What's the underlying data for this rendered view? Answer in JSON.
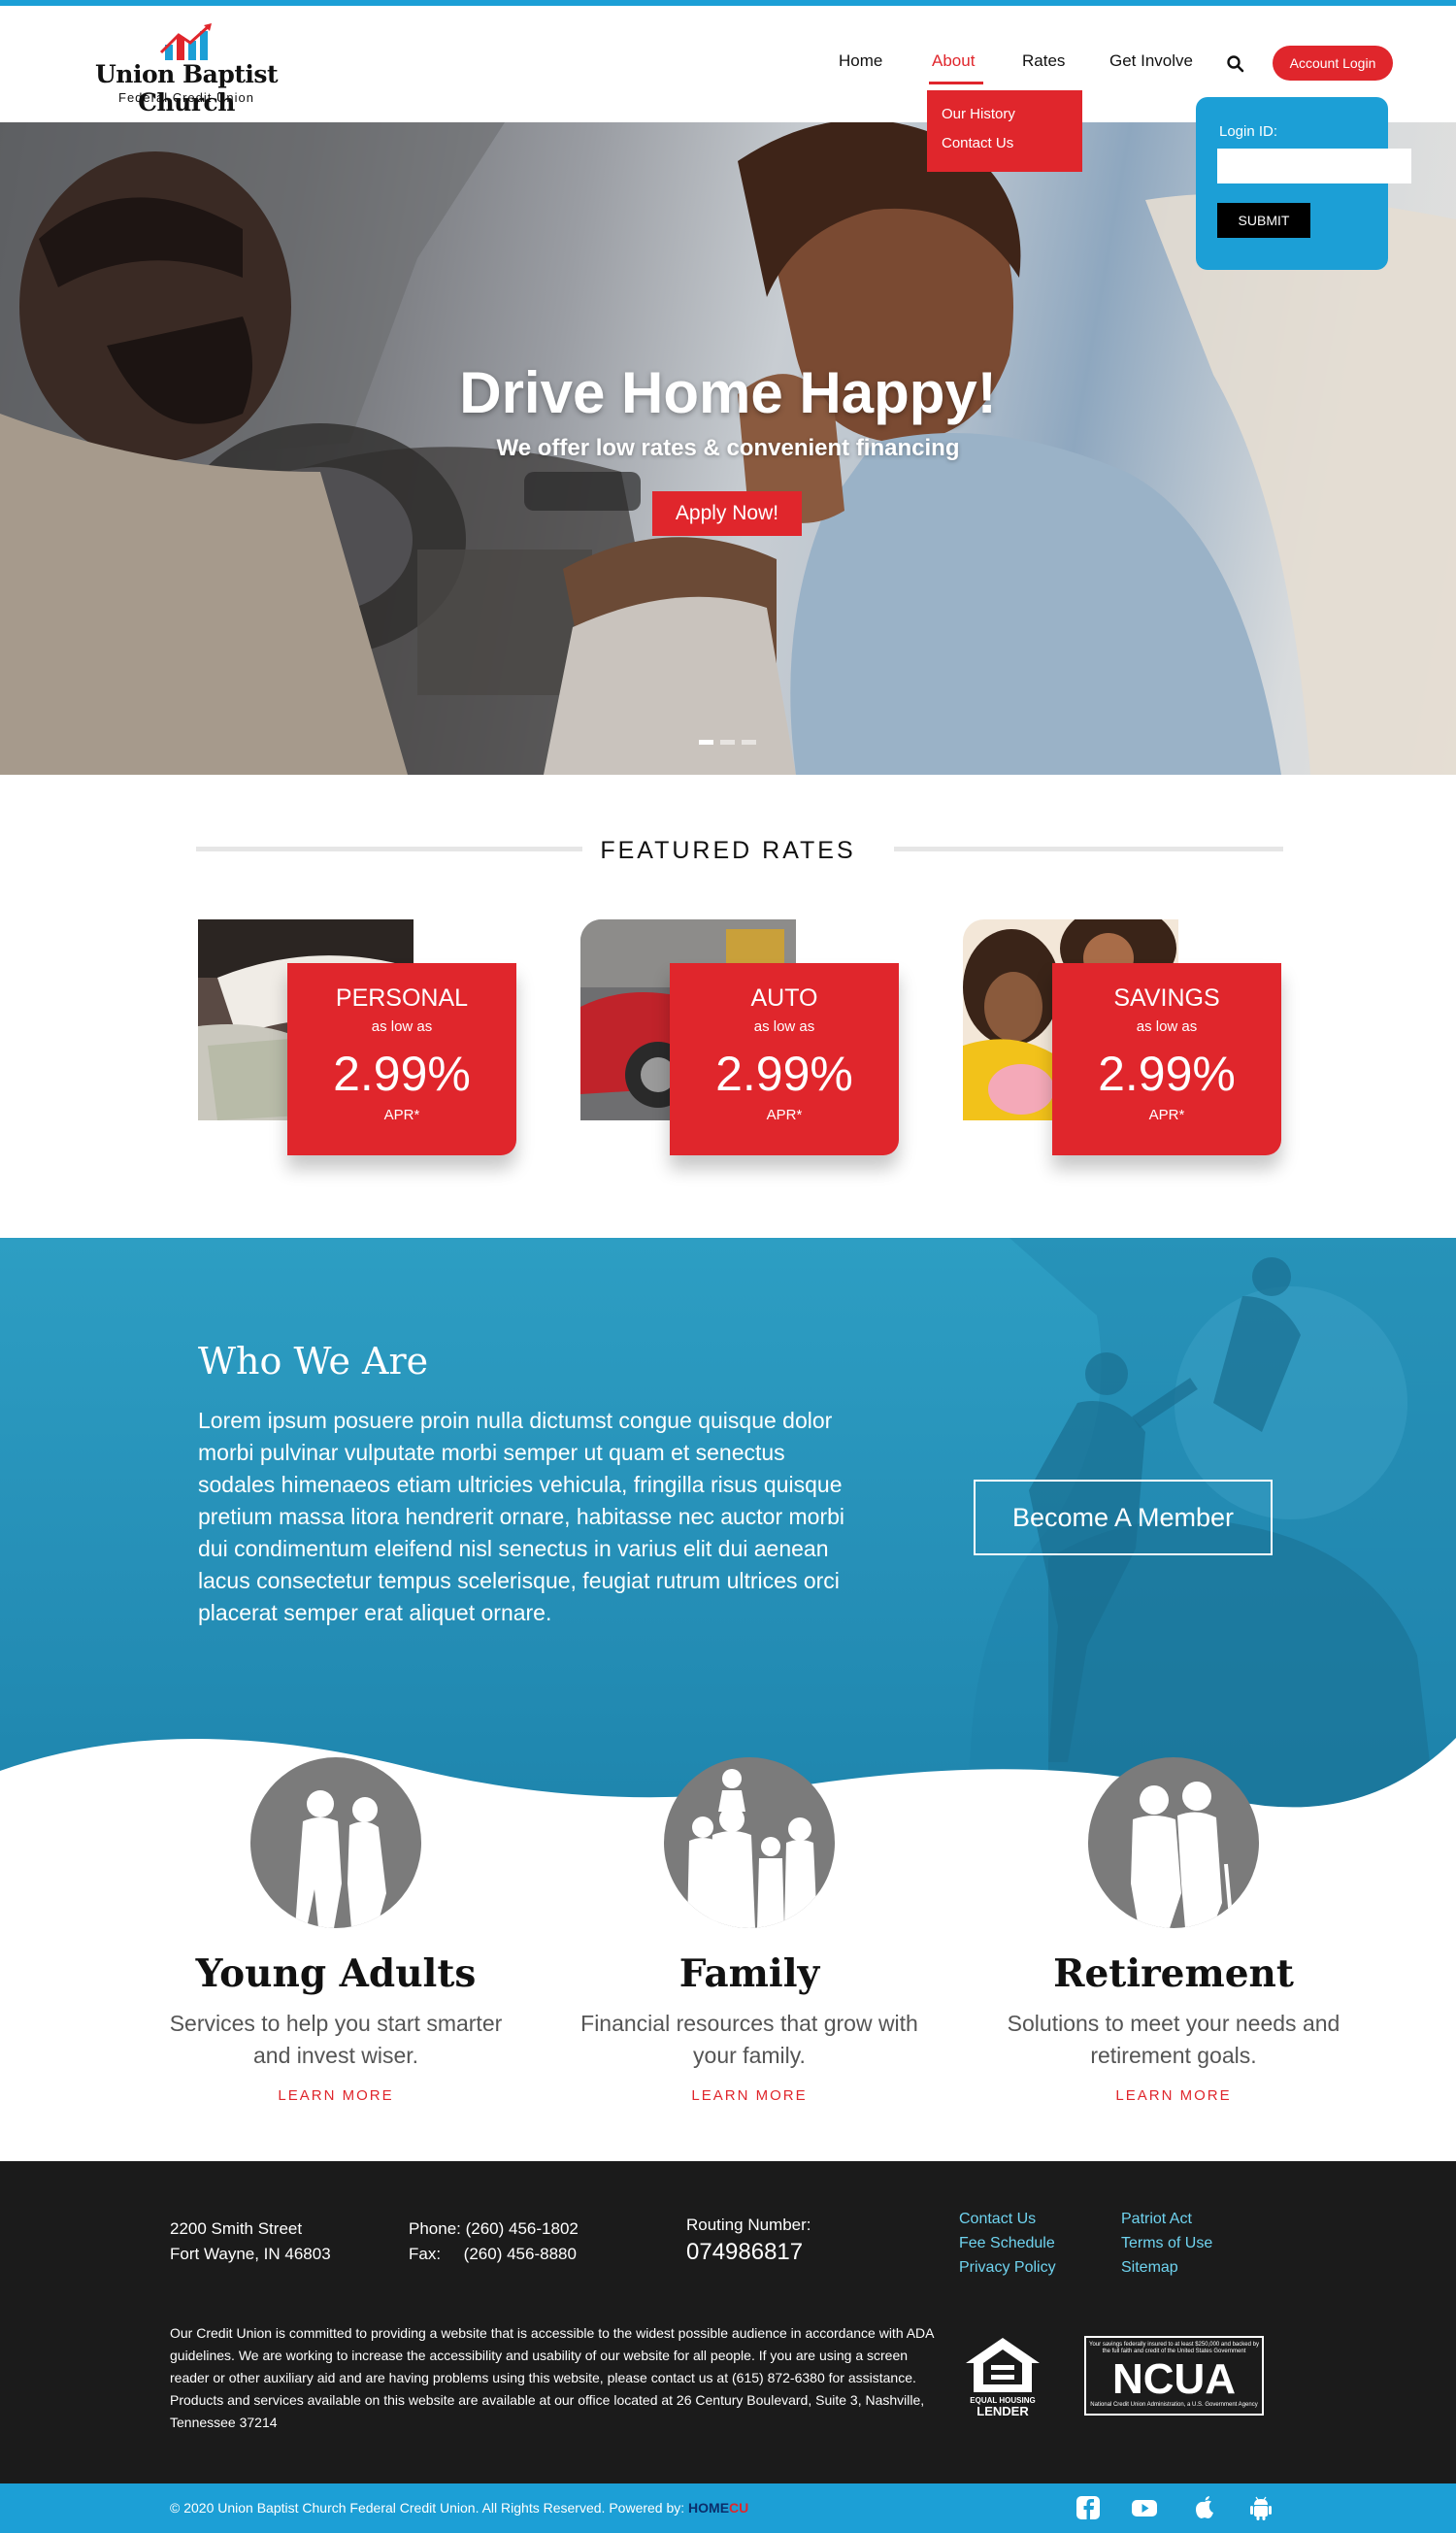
{
  "header": {
    "logo_name": "Union Baptist Church",
    "logo_sub": "Federal Credit Union",
    "nav": [
      {
        "label": "Home"
      },
      {
        "label": "About"
      },
      {
        "label": "Rates"
      },
      {
        "label": "Get Involve"
      }
    ],
    "active_nav": "About",
    "account_login": "Account Login",
    "dropdown": [
      "Our History",
      "Contact Us"
    ]
  },
  "login": {
    "label": "Login ID:",
    "input_value": "",
    "submit": "SUBMIT"
  },
  "hero": {
    "title": "Drive Home Happy!",
    "subtitle": "We offer low rates & convenient financing",
    "button": "Apply Now!",
    "slides": 3,
    "active_slide": 1
  },
  "featured": {
    "title": "FEATURED RATES",
    "cards": [
      {
        "name": "PERSONAL",
        "as_low_as": "as low as",
        "rate": "2.99%",
        "apr": "APR*"
      },
      {
        "name": "AUTO",
        "as_low_as": "as low as",
        "rate": "2.99%",
        "apr": "APR*"
      },
      {
        "name": "SAVINGS",
        "as_low_as": "as low as",
        "rate": "2.99%",
        "apr": "APR*"
      }
    ]
  },
  "who": {
    "title": "Who We Are",
    "text": "Lorem ipsum posuere proin nulla dictumst congue quisque dolor morbi pulvinar vulputate morbi semper ut quam et senectus sodales himenaeos etiam ultricies vehicula, fringilla risus quisque pretium massa litora hendrerit ornare, habitasse nec auctor morbi dui condimentum eleifend nisl senectus in varius elit dui aenean lacus consectetur tempus scelerisque, feugiat rutrum ultrices orci placerat semper erat aliquet ornare.",
    "button": "Become A Member"
  },
  "services": [
    {
      "title": "Young Adults",
      "desc": "Services to help you start smarter and invest wiser.",
      "link": "LEARN MORE"
    },
    {
      "title": "Family",
      "desc": "Financial resources that grow with your family.",
      "link": "LEARN MORE"
    },
    {
      "title": "Retirement",
      "desc": "Solutions to meet your needs and retirement goals.",
      "link": "LEARN MORE"
    }
  ],
  "footer": {
    "address_line1": "2200 Smith Street",
    "address_line2": "Fort Wayne, IN 46803",
    "phone": "Phone: (260) 456-1802",
    "fax": "Fax:     (260) 456-8880",
    "routing_label": "Routing Number:",
    "routing_number": "074986817",
    "links_col1": [
      "Contact Us",
      "Fee Schedule",
      "Privacy Policy"
    ],
    "links_col2": [
      "Patriot Act",
      "Terms of Use",
      "Sitemap"
    ],
    "legal": "Our Credit Union is committed to providing a website that is accessible to the widest possible audience in accordance with ADA guidelines. We are working to increase the accessibility and usability of our website for all people. If you are using a screen reader or other auxiliary aid and are having problems using this website, please contact us at (615) 872-6380 for assistance. Products and services available on this website are available at our office located at 26 Century Boulevard, Suite 3, Nashville, Tennessee 37214",
    "ehl_line1": "EQUAL HOUSING",
    "ehl_line2": "LENDER",
    "ncua_small": "Your savings federally insured to at least $250,000 and backed by the full faith and credit of the United States Government",
    "ncua_word": "NCUA",
    "ncua_bottom": "National Credit Union Administration, a U.S. Government Agency",
    "copyright": "© 2020 Union Baptist Church Federal Credit Union. All Rights Reserved.",
    "powered_by": "Powered by:",
    "brand_a": "HOME",
    "brand_b": "CU"
  },
  "colors": {
    "accent_red": "#e0262c",
    "accent_blue": "#1c9fd6",
    "footer_bg": "#1b1b1b",
    "link_cyan": "#6fd3ef"
  },
  "icons": [
    "logo-bars-icon",
    "search-icon",
    "facebook-icon",
    "youtube-icon",
    "apple-icon",
    "android-icon",
    "equal-housing-icon"
  ]
}
